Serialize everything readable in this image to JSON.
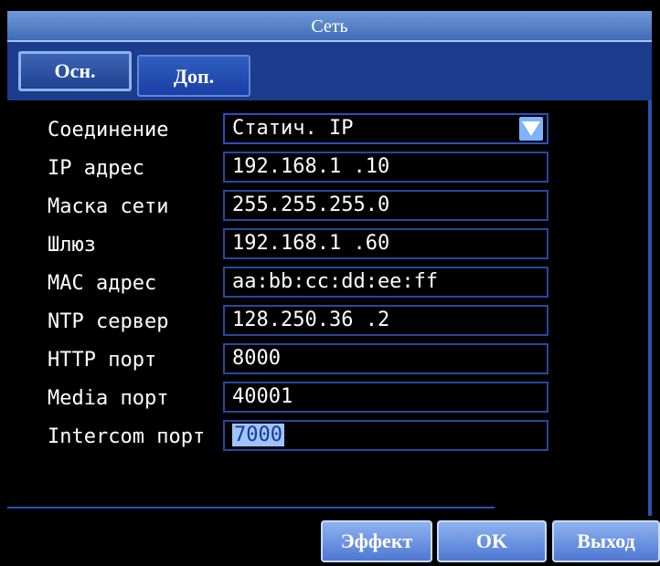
{
  "window": {
    "title": "Сеть"
  },
  "tabs": [
    {
      "label": "Осн.",
      "active": true
    },
    {
      "label": "Доп.",
      "active": false
    }
  ],
  "fields": {
    "connection": {
      "label": "Соединение",
      "value": "Статич. IP"
    },
    "ip": {
      "label": "IP адрес",
      "value": "192.168.1  .10"
    },
    "mask": {
      "label": "Маска сети",
      "value": "255.255.255.0"
    },
    "gateway": {
      "label": "Шлюз",
      "value": "192.168.1  .60"
    },
    "mac": {
      "label": "MAC адрес",
      "value": "aa:bb:cc:dd:ee:ff"
    },
    "ntp": {
      "label": "NTP сервер",
      "value": "128.250.36 .2"
    },
    "http": {
      "label": "HTTP порт",
      "value": "8000"
    },
    "media": {
      "label": "Media порт",
      "value": "40001"
    },
    "intercom": {
      "label": "Intercom порт",
      "value": "7000"
    }
  },
  "buttons": {
    "effect": "Эффект",
    "ok": "OK",
    "exit": "Выход"
  },
  "colors": {
    "accent": "#3f6cb6",
    "tab_strip": "#1c3c8e",
    "field_border": "#2748a0",
    "dropdown": "#7fb3ff",
    "selection": "#9ec4ff"
  },
  "icons": {
    "dropdown": "chevron-down-icon"
  }
}
